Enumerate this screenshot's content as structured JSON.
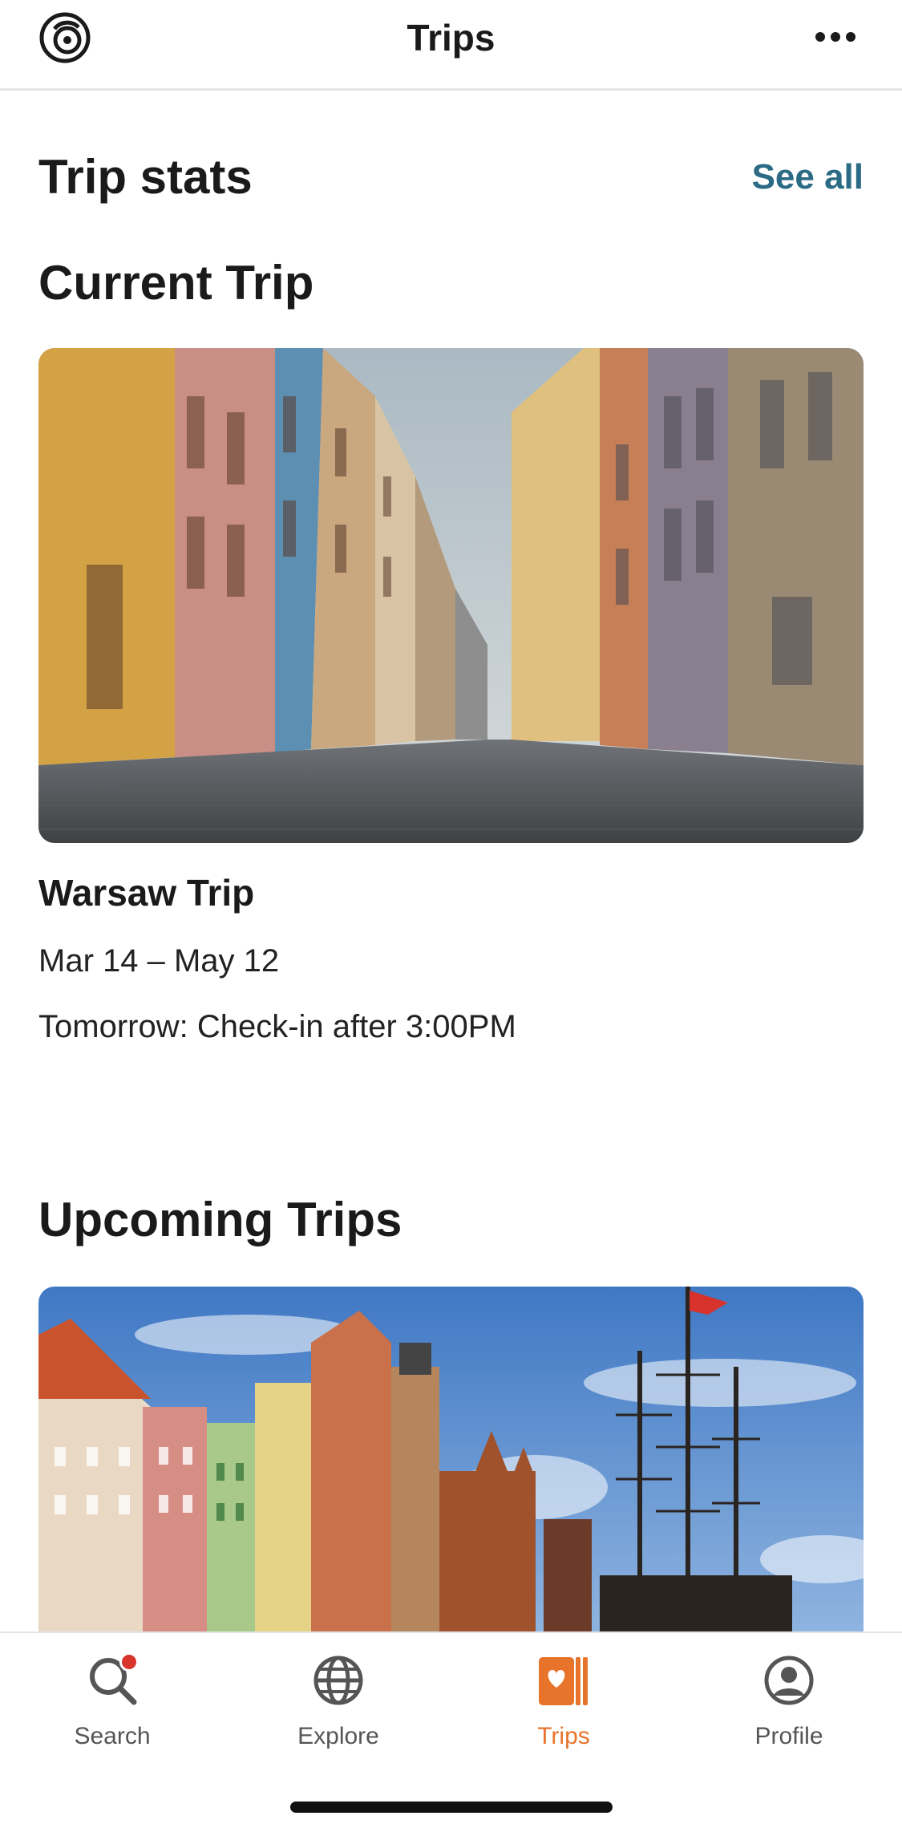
{
  "header": {
    "title": "Trips",
    "logo_icon": "app-logo-icon",
    "more_icon": "more-options-icon"
  },
  "stats": {
    "title": "Trip stats",
    "see_all": "See all"
  },
  "current": {
    "section_title": "Current Trip",
    "trip_name": "Warsaw Trip",
    "dates": "Mar 14 – May 12",
    "note": "Tomorrow: Check-in after 3:00PM"
  },
  "upcoming": {
    "section_title": "Upcoming Trips"
  },
  "tabs": [
    {
      "label": "Search",
      "icon": "search-icon"
    },
    {
      "label": "Explore",
      "icon": "globe-icon"
    },
    {
      "label": "Trips",
      "icon": "trips-icon"
    },
    {
      "label": "Profile",
      "icon": "profile-icon"
    }
  ],
  "colors": {
    "accent": "#e8742b",
    "link": "#2b6b85",
    "badge": "#d9342b"
  }
}
